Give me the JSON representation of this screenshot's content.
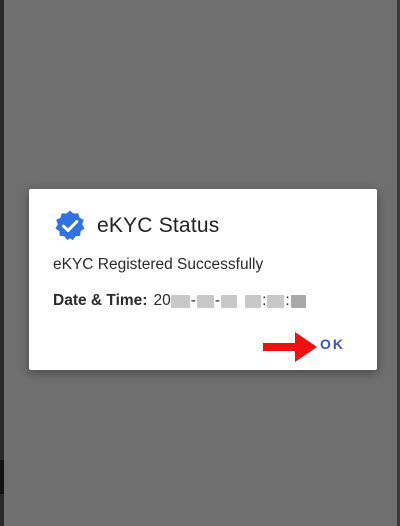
{
  "dialog": {
    "title": "eKYC Status",
    "icon": "verified-badge-icon",
    "message": "eKYC Registered Successfully",
    "datetime_label": "Date & Time:",
    "datetime_prefix": "20",
    "ok_label": "OK"
  },
  "colors": {
    "badge_blue": "#2f73e0",
    "ok_text": "#3f51b5",
    "arrow_red": "#ee1111",
    "scrim": "#6f6f6f"
  }
}
